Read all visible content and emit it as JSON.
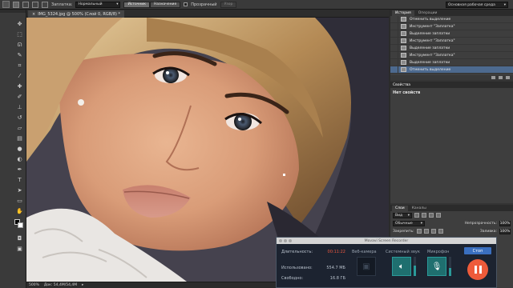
{
  "options_bar": {
    "patch_label": "Заплатка:",
    "patch_mode": "Нормальный",
    "source_label": "Источник",
    "target_label": "Назначение",
    "transparent_label": "Прозрачный",
    "use_pattern_label": "Узор",
    "workspace": "Основная рабочая среда"
  },
  "document": {
    "tab_label": "IMG_5324.jpg @ 500% (Слой 0, RGB/8) *",
    "zoom": "500%",
    "doc_info": "Док: 54,4M/54,4M"
  },
  "history_panel": {
    "tabs": [
      "История",
      "Операции"
    ],
    "items": [
      "Отменить выделение",
      "Инструмент \"Заплатка\"",
      "Выделение заплатки",
      "Инструмент \"Заплатка\"",
      "Выделение заплатки",
      "Инструмент \"Заплатка\"",
      "Выделение заплатки",
      "Отменить выделение"
    ],
    "selected_index": 7
  },
  "properties_panel": {
    "title": "Свойства",
    "body": "Нет свойств"
  },
  "layers_panel": {
    "tabs": [
      "Слои",
      "Каналы"
    ],
    "kind": "Вид",
    "blend_mode": "Обычные",
    "opacity_label": "Непрозрачность:",
    "opacity": "100%",
    "lock_label": "Закрепить:",
    "fill_label": "Заливка:",
    "fill": "100%"
  },
  "recorder": {
    "title": "Movavi Screen Recorder",
    "duration_label": "Длительность:",
    "duration": "00:11:22",
    "used_label": "Использовано:",
    "used": "554.7 МБ",
    "free_label": "Свободно:",
    "free": "16.8 ГБ",
    "webcam_label": "Веб-камера",
    "system_sound_label": "Системный звук",
    "mic_label": "Микрофон",
    "stop_label": "Стоп",
    "system_sound_level": 0.55,
    "mic_level": 0.4
  },
  "colors": {
    "accent_rec": "#ee5b3a",
    "accent_tile": "#1f6f6f",
    "history_selected": "#4d6a8f"
  }
}
